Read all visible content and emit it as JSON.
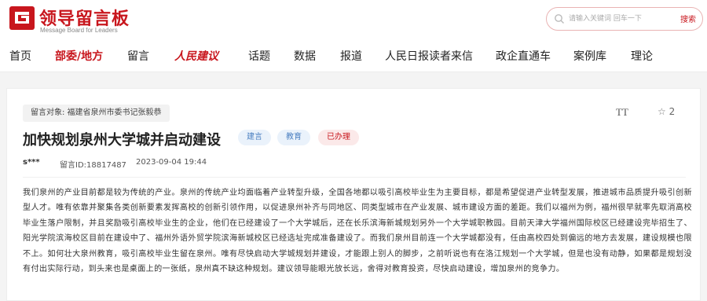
{
  "header": {
    "logo_title": "领导留言板",
    "logo_subtitle": "Message Board for Leaders",
    "search_placeholder": "请输入关键词 回车一下",
    "search_button": "搜索"
  },
  "nav": [
    {
      "label": "首页"
    },
    {
      "label": "部委/地方"
    },
    {
      "label": "留言"
    },
    {
      "label": "人民建议"
    },
    {
      "label": "话题"
    },
    {
      "label": "数据"
    },
    {
      "label": "报道"
    },
    {
      "label": "人民日报读者来信"
    },
    {
      "label": "政企直通车"
    },
    {
      "label": "案例库"
    },
    {
      "label": "理论"
    }
  ],
  "colors": {
    "brand": "#c8161d",
    "tag_blue": "#4a7fc1",
    "background": "#f4f4f4"
  },
  "message": {
    "target": "留言对象:   福建省泉州市委书记张毅恭",
    "font_size_button": "TT",
    "favorite_count": "2",
    "title": "加快规划泉州大学城并启动建设",
    "tags": [
      "建言",
      "教育",
      "已办理"
    ],
    "user": "s***",
    "message_id": "留言ID:18817487",
    "date": "2023-09-04 19:44",
    "body": "我们泉州的产业目前都是较为传统的产业。泉州的传统产业均面临着产业转型升级，全国各地都以吸引高校毕业生为主要目标，都是希望促进产业转型发展，推进城市品质提升吸引创新型人才。唯有依靠并聚集各类创新要素发挥高校的创新引领作用，以促进泉州补齐与同地区、同类型城市在产业发展、城市建设方面的差距。我们以福州为例，福州很早就率先取消高校毕业生落户限制，并且奖励吸引高校毕业生的企业，他们在已经建设了一个大学城后，还在长乐滨海新城规划另外一个大学城职教园。目前天津大学福州国际校区已经建设完毕招生了、阳光学院滨海校区目前在建设中了、福州外语外贸学院滨海新城校区已经选址完成准备建设了。而我们泉州目前连一个大学城都没有，任由高校四处到偏远的地方去发展，建设规模也限不上。如何壮大泉州教育，吸引高校毕业生留在泉州。唯有尽快启动大学城规划并建设，才能跟上别人的脚步，之前听说也有在洛江规划一个大学城，但是也没有动静，如果都是规划没有付出实际行动，到头来也是桌面上的一张纸，泉州真不缺这种规划。建议领导能眼光放长远，舍得对教育投资，尽快启动建设，增加泉州的竞争力。"
  }
}
